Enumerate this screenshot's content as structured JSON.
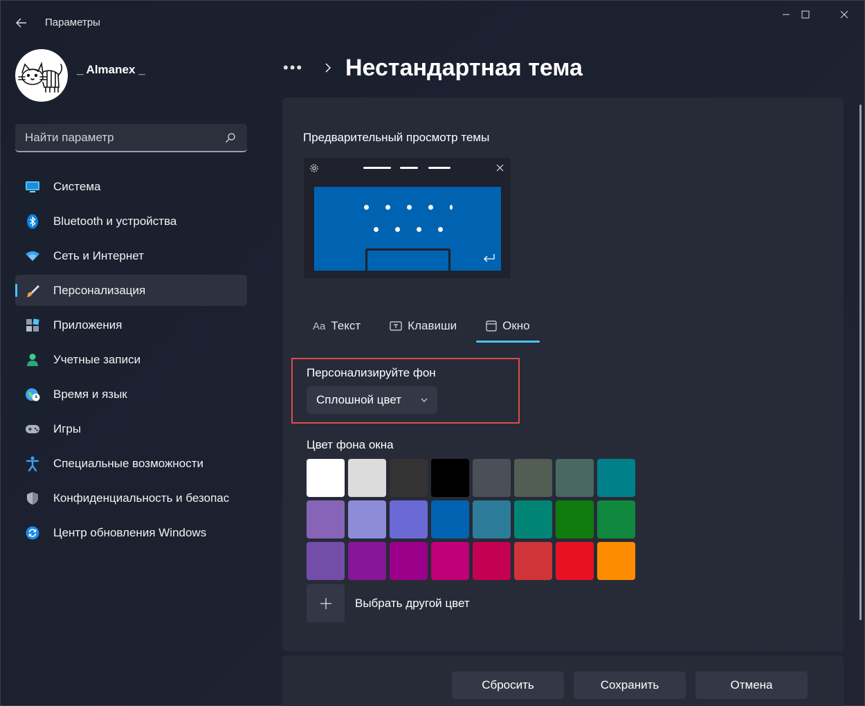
{
  "app": {
    "title": "Параметры",
    "colors": {
      "accent": "#4cc2ff",
      "highlight": "#e14a4a"
    }
  },
  "window_controls": {
    "minimize": "minimize-icon",
    "maximize": "maximize-icon",
    "close": "close-icon"
  },
  "user": {
    "name": "_ Almanex _"
  },
  "search": {
    "placeholder": "Найти параметр"
  },
  "sidebar": {
    "items": [
      {
        "label": "Система",
        "icon": "system-icon"
      },
      {
        "label": "Bluetooth и устройства",
        "icon": "bluetooth-icon"
      },
      {
        "label": "Сеть и Интернет",
        "icon": "wifi-icon"
      },
      {
        "label": "Персонализация",
        "icon": "brush-icon",
        "active": true
      },
      {
        "label": "Приложения",
        "icon": "apps-icon"
      },
      {
        "label": "Учетные записи",
        "icon": "user-icon"
      },
      {
        "label": "Время и язык",
        "icon": "globe-icon"
      },
      {
        "label": "Игры",
        "icon": "gamepad-icon"
      },
      {
        "label": "Специальные возможности",
        "icon": "accessibility-icon"
      },
      {
        "label": "Конфиденциальность и безопасность",
        "icon": "shield-icon"
      },
      {
        "label": "Центр обновления Windows",
        "icon": "update-icon"
      }
    ]
  },
  "header": {
    "more": "•••",
    "title": "Нестандартная тема"
  },
  "preview": {
    "title": "Предварительный просмотр темы",
    "color": "#0063b1"
  },
  "tabs": [
    {
      "label": "Текст",
      "icon_text": "Aa"
    },
    {
      "label": "Клавиши"
    },
    {
      "label": "Окно",
      "active": true
    }
  ],
  "background": {
    "label": "Персонализируйте фон",
    "selected": "Сплошной цвет"
  },
  "window_color": {
    "label": "Цвет фона окна",
    "swatches": [
      "#ffffff",
      "#dcdcdc",
      "#333333",
      "#000000",
      "#4a5057",
      "#525e54",
      "#486860",
      "#00818a",
      "#8764b8",
      "#8e8cd8",
      "#6b69d6",
      "#0063b1",
      "#2d7d9a",
      "#008575",
      "#107c10",
      "#10893e",
      "#744da9",
      "#881798",
      "#9a0089",
      "#bf0077",
      "#c30052",
      "#d13438",
      "#e81123",
      "#ff8c00"
    ],
    "add_label": "Выбрать другой цвет"
  },
  "footer": {
    "reset": "Сбросить",
    "save": "Сохранить",
    "cancel": "Отмена"
  }
}
